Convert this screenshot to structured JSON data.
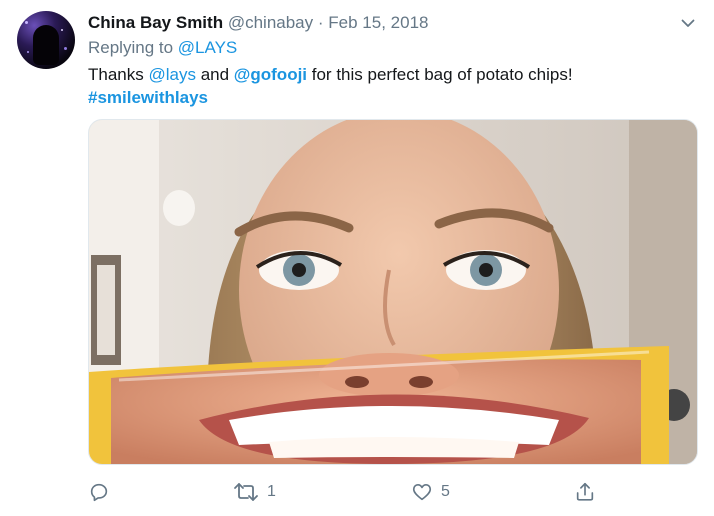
{
  "tweet": {
    "author": {
      "name": "China Bay Smith",
      "handle": "@chinabay",
      "avatar_icon": "avatar-image"
    },
    "separator": "·",
    "date": "Feb 15, 2018",
    "replying_prefix": "Replying to",
    "replying_to": "@LAYS",
    "text_parts": {
      "p1": "Thanks ",
      "mention1": "@lays",
      "p2": " and ",
      "mention2": "@gofooji",
      "p3": " for this perfect bag of potato chips!",
      "hashtag": "#smilewithlays"
    },
    "menu_icon": "chevron-down-icon",
    "actions": {
      "reply_icon": "reply-icon",
      "retweet_icon": "retweet-icon",
      "retweet_count": "1",
      "like_icon": "heart-icon",
      "like_count": "5",
      "share_icon": "share-icon"
    }
  },
  "colors": {
    "link": "#1b95e0",
    "secondary_text": "#657786",
    "primary_text": "#14171a"
  }
}
